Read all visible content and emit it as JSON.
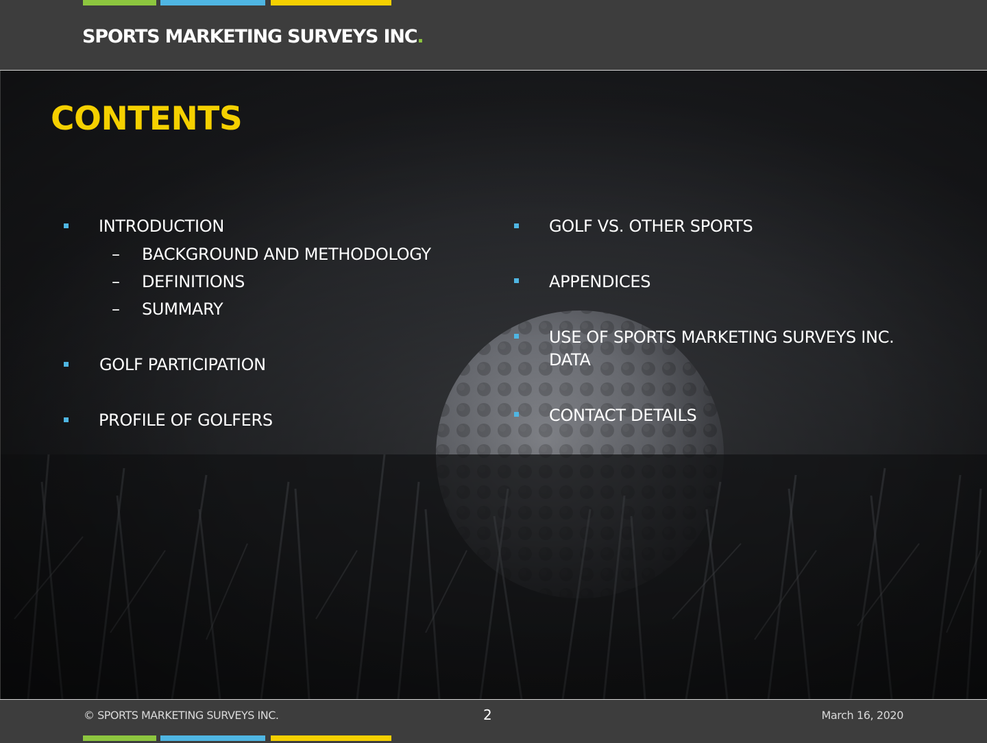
{
  "header": {
    "brand": "SPORTS MARKETING SURVEYS INC",
    "brand_dot": ".",
    "stripe_colors": [
      "#8dc63f",
      "#4fb6e3",
      "#f5d000"
    ]
  },
  "slide": {
    "title": "CONTENTS",
    "left_column": {
      "introduction": "INTRODUCTION",
      "sub_items": [
        "BACKGROUND AND METHODOLOGY",
        "DEFINITIONS",
        "SUMMARY"
      ],
      "golf_participation": "GOLF PARTICIPATION",
      "profile_of_golfers": "PROFILE OF GOLFERS"
    },
    "right_column": {
      "golf_vs_other_sports": "GOLF VS. OTHER SPORTS",
      "appendices": "APPENDICES",
      "use_of_data_line1": "USE OF SPORTS MARKETING SURVEYS INC.",
      "use_of_data_line2": "DATA",
      "contact_details": "CONTACT DETAILS"
    },
    "dash_glyph": "–",
    "colors": {
      "title": "#f5d000",
      "bullet": "#4fb6e3",
      "text": "#ffffff"
    },
    "background_image": "golf-ball-in-grass-photo"
  },
  "footer": {
    "copyright": "© SPORTS MARKETING SURVEYS INC.",
    "page_number": "2",
    "date": "March 16, 2020"
  }
}
